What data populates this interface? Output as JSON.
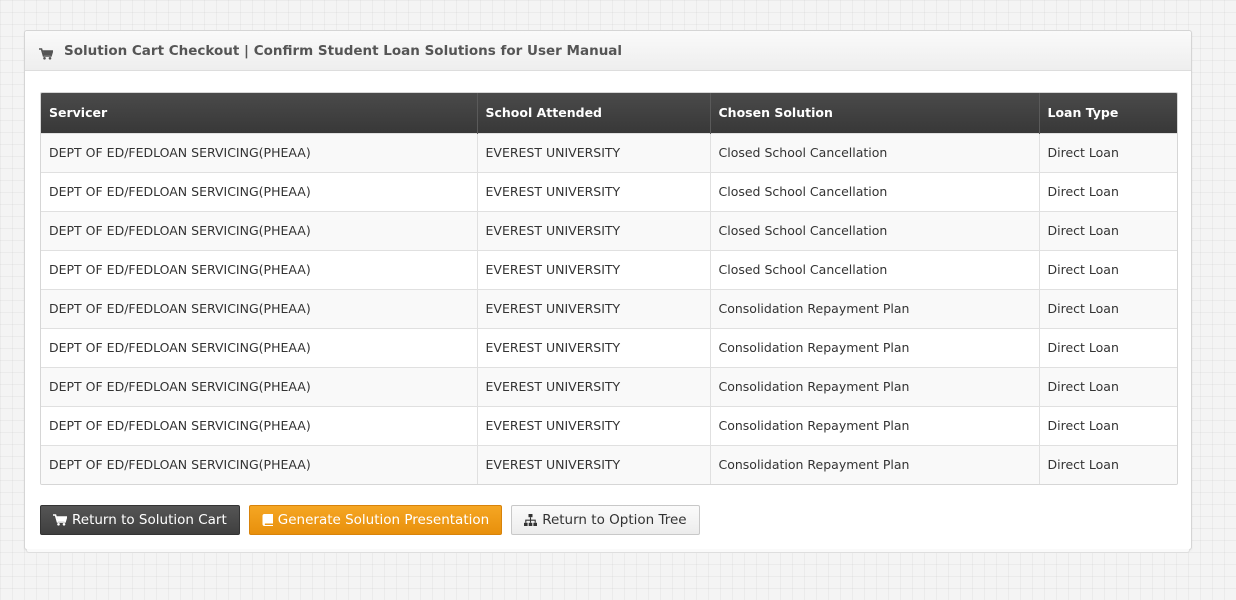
{
  "panel": {
    "title": "Solution Cart Checkout | Confirm Student Loan Solutions for User Manual",
    "icon": "cart-icon"
  },
  "table": {
    "headers": [
      "Servicer",
      "School Attended",
      "Chosen Solution",
      "Loan Type"
    ],
    "rows": [
      [
        "DEPT OF ED/FEDLOAN SERVICING(PHEAA)",
        "EVEREST UNIVERSITY",
        "Closed School Cancellation",
        "Direct Loan"
      ],
      [
        "DEPT OF ED/FEDLOAN SERVICING(PHEAA)",
        "EVEREST UNIVERSITY",
        "Closed School Cancellation",
        "Direct Loan"
      ],
      [
        "DEPT OF ED/FEDLOAN SERVICING(PHEAA)",
        "EVEREST UNIVERSITY",
        "Closed School Cancellation",
        "Direct Loan"
      ],
      [
        "DEPT OF ED/FEDLOAN SERVICING(PHEAA)",
        "EVEREST UNIVERSITY",
        "Closed School Cancellation",
        "Direct Loan"
      ],
      [
        "DEPT OF ED/FEDLOAN SERVICING(PHEAA)",
        "EVEREST UNIVERSITY",
        "Consolidation Repayment Plan",
        "Direct Loan"
      ],
      [
        "DEPT OF ED/FEDLOAN SERVICING(PHEAA)",
        "EVEREST UNIVERSITY",
        "Consolidation Repayment Plan",
        "Direct Loan"
      ],
      [
        "DEPT OF ED/FEDLOAN SERVICING(PHEAA)",
        "EVEREST UNIVERSITY",
        "Consolidation Repayment Plan",
        "Direct Loan"
      ],
      [
        "DEPT OF ED/FEDLOAN SERVICING(PHEAA)",
        "EVEREST UNIVERSITY",
        "Consolidation Repayment Plan",
        "Direct Loan"
      ],
      [
        "DEPT OF ED/FEDLOAN SERVICING(PHEAA)",
        "EVEREST UNIVERSITY",
        "Consolidation Repayment Plan",
        "Direct Loan"
      ]
    ]
  },
  "buttons": {
    "return_cart": "Return to Solution Cart",
    "generate": "Generate Solution Presentation",
    "return_tree": "Return to Option Tree"
  },
  "colors": {
    "header_dark": "#3d3d3d",
    "orange": "#f0a01b",
    "dark_button": "#484848"
  }
}
